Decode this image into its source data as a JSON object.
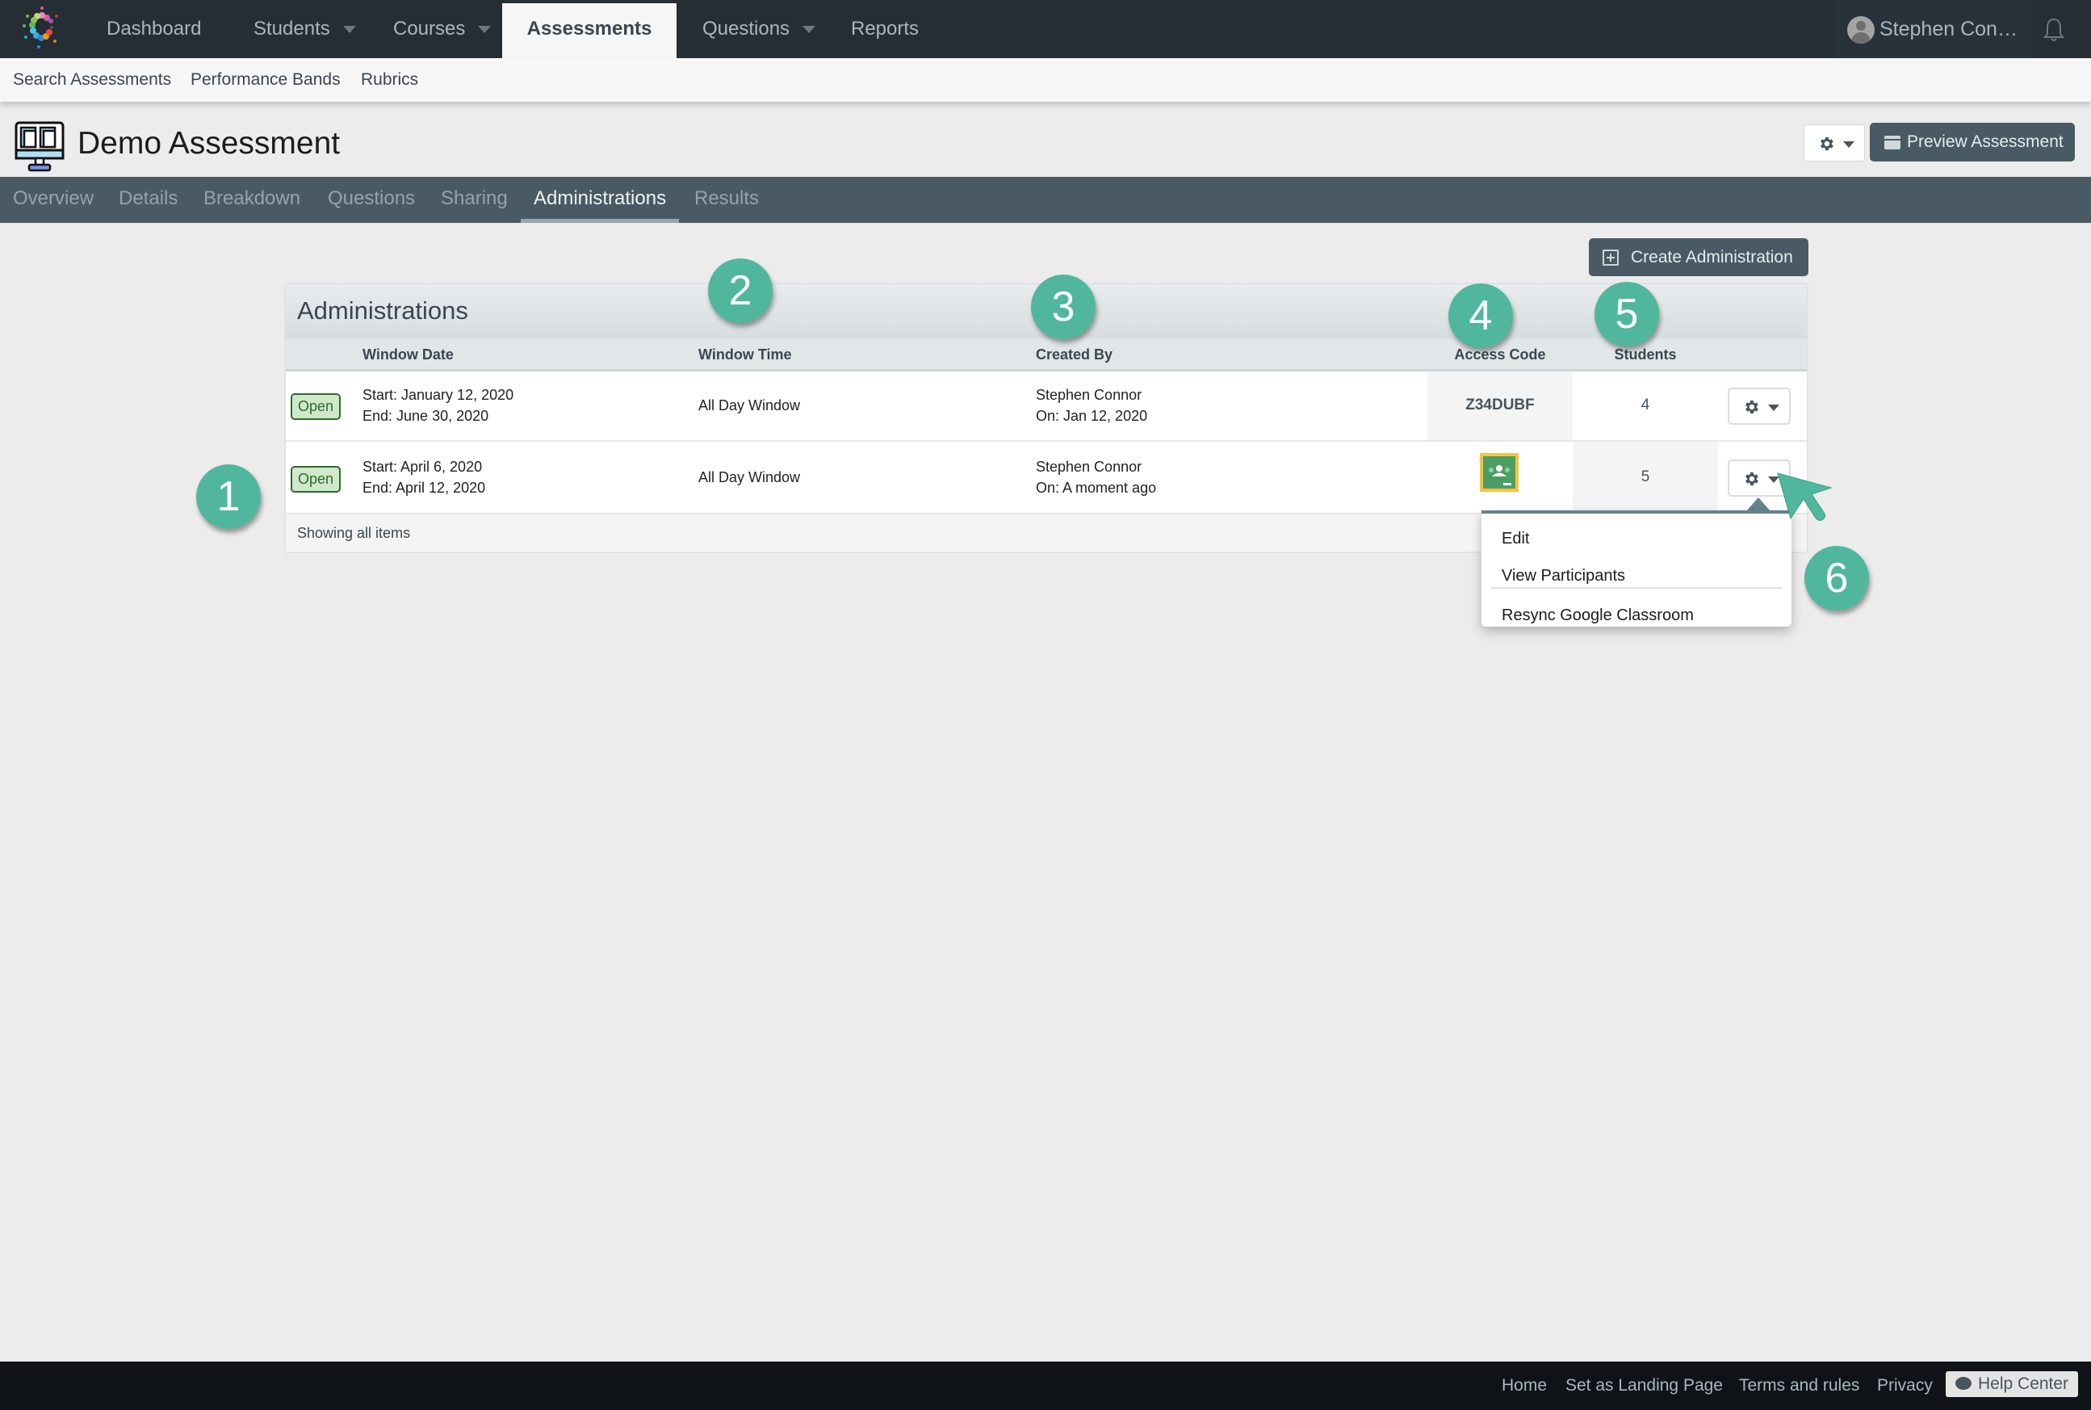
{
  "topnav": {
    "items": [
      {
        "label": "Dashboard",
        "has_caret": false
      },
      {
        "label": "Students",
        "has_caret": true
      },
      {
        "label": "Courses",
        "has_caret": true
      },
      {
        "label": "Assessments",
        "has_caret": false,
        "active": true
      },
      {
        "label": "Questions",
        "has_caret": true
      },
      {
        "label": "Reports",
        "has_caret": false
      }
    ],
    "user_name": "Stephen Con…",
    "icons": {
      "logo": "starburst-logo",
      "avatar": "user-avatar-icon",
      "bell": "bell-icon"
    }
  },
  "subnav": {
    "items": [
      "Search Assessments",
      "Performance Bands",
      "Rubrics"
    ]
  },
  "page": {
    "title": "Demo Assessment",
    "preview_button": "Preview Assessment",
    "settings_icon": "gear-icon"
  },
  "tabs": {
    "items": [
      "Overview",
      "Details",
      "Breakdown",
      "Questions",
      "Sharing",
      "Administrations",
      "Results"
    ],
    "active": "Administrations"
  },
  "create_button": "Create Administration",
  "administrations": {
    "title": "Administrations",
    "columns": [
      "Window Date",
      "Window Time",
      "Created By",
      "Access Code",
      "Students"
    ],
    "rows": [
      {
        "status": "Open",
        "start": "Start: January 12, 2020",
        "end": "End: June 30, 2020",
        "window_time": "All Day Window",
        "created_by": "Stephen Connor",
        "created_on": "On: Jan 12, 2020",
        "access_code": "Z34DUBF",
        "students": "4"
      },
      {
        "status": "Open",
        "start": "Start: April 6, 2020",
        "end": "End: April 12, 2020",
        "window_time": "All Day Window",
        "created_by": "Stephen Connor",
        "created_on": "On: A moment ago",
        "access_code_icon": "google-classroom-icon",
        "students": "5"
      }
    ],
    "footer": "Showing all items"
  },
  "dropdown_menu": {
    "items": [
      "Edit",
      "View Participants",
      "Resync Google Classroom"
    ]
  },
  "annotations": [
    "1",
    "2",
    "3",
    "4",
    "5",
    "6"
  ],
  "colors": {
    "topnav_bg": "#252d35",
    "tabs_bg": "#4a5a64",
    "annotation": "#50b79e",
    "badge_open_bg": "#cfe8c9",
    "badge_open_text": "#2f6b2c",
    "classroom_green": "#4a9e63",
    "classroom_border": "#f6c342"
  },
  "footer": {
    "links": [
      "Home",
      "Set as Landing Page",
      "Terms and rules",
      "Privacy"
    ],
    "help": "Help Center"
  }
}
